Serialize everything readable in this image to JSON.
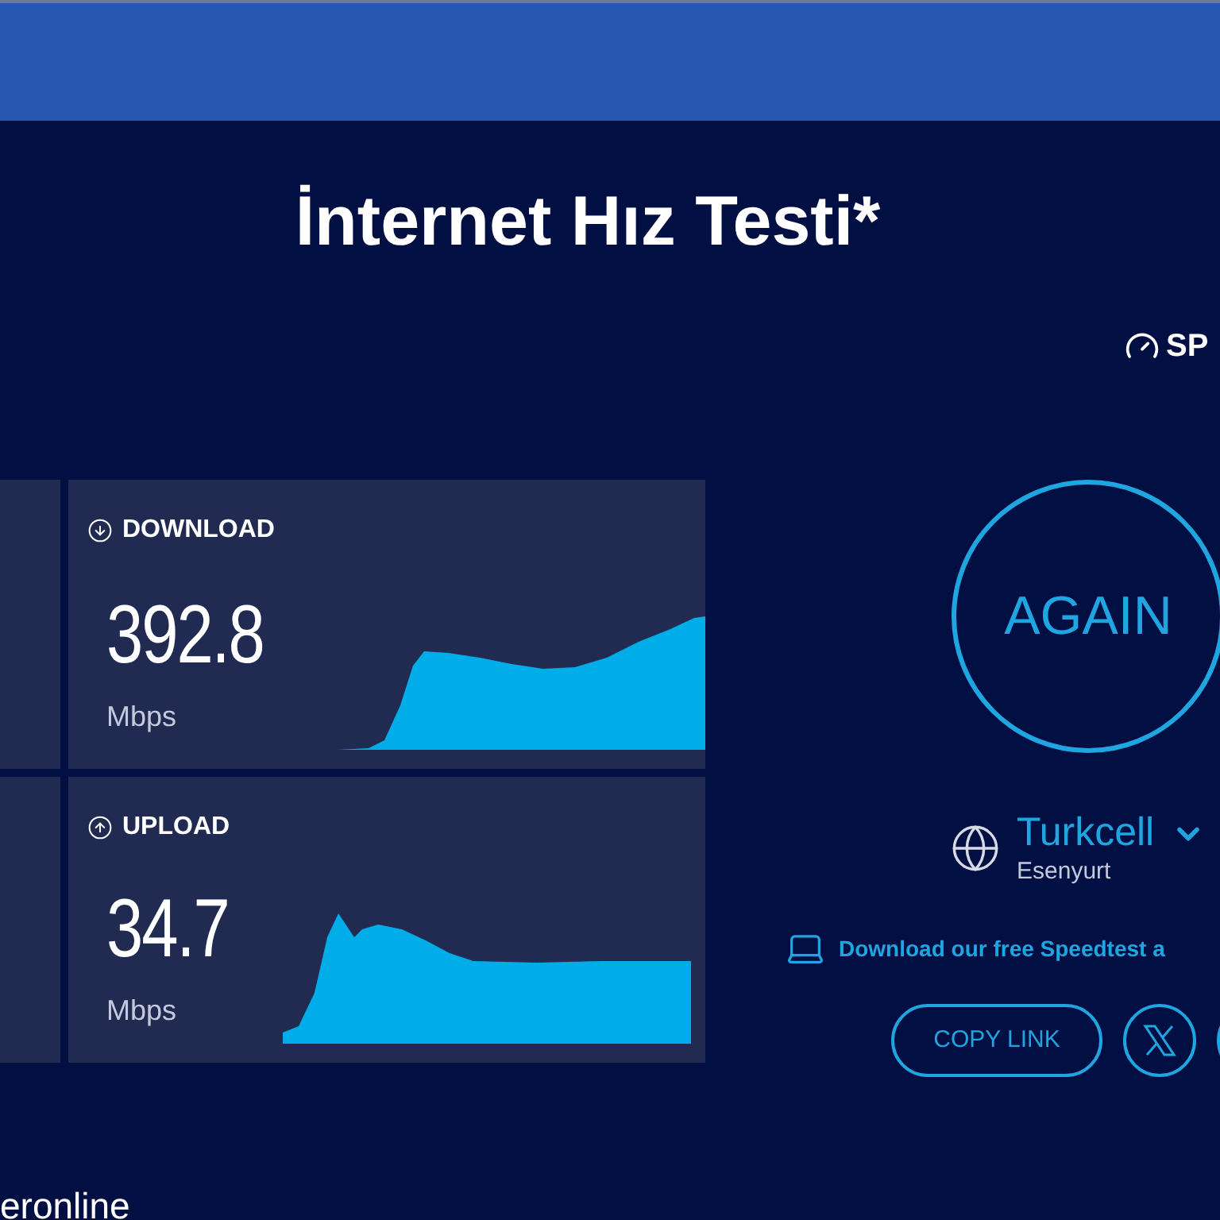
{
  "page": {
    "title": "İnternet Hız Testi*",
    "brand_fragment": "SP"
  },
  "results": [
    {
      "kind": "download",
      "label": "DOWNLOAD",
      "value": "392.8",
      "unit": "Mbps"
    },
    {
      "kind": "upload",
      "label": "UPLOAD",
      "value": "34.7",
      "unit": "Mbps"
    }
  ],
  "again_button": "AGAIN",
  "provider": {
    "name": "Turkcell",
    "location": "Esenyurt"
  },
  "app_link": "Download our free Speedtest a",
  "share": {
    "copy_link": "COPY LINK"
  },
  "footer": "eronline"
}
